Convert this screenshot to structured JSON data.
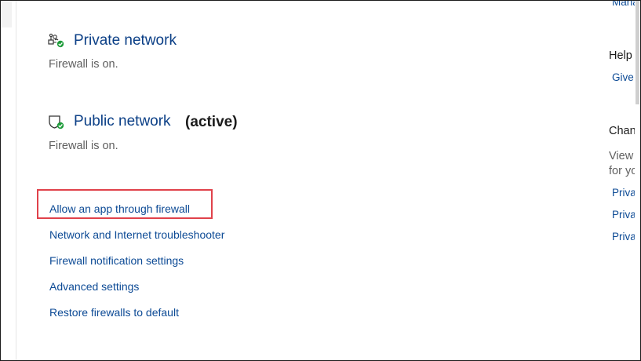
{
  "networks": [
    {
      "title": "Private network",
      "active_label": "",
      "status": "Firewall is on.",
      "icon": "private-network-icon"
    },
    {
      "title": "Public network",
      "active_label": "(active)",
      "status": "Firewall is on.",
      "icon": "public-network-icon"
    }
  ],
  "links": [
    "Allow an app through firewall",
    "Network and Internet troubleshooter",
    "Firewall notification settings",
    "Advanced settings",
    "Restore firewalls to default"
  ],
  "right_panel": {
    "top_link": "Mana",
    "help_heading": "Help i",
    "help_link": "Give u",
    "change_heading": "Chang",
    "change_body_1": "View a",
    "change_body_2": "for yo",
    "privacy_links": [
      "Privac",
      "Privac",
      "Privac"
    ]
  },
  "colors": {
    "link": "#0c4a95",
    "title": "#0b3f86",
    "status_ok": "#1e9b3a",
    "highlight": "#e0424b"
  }
}
